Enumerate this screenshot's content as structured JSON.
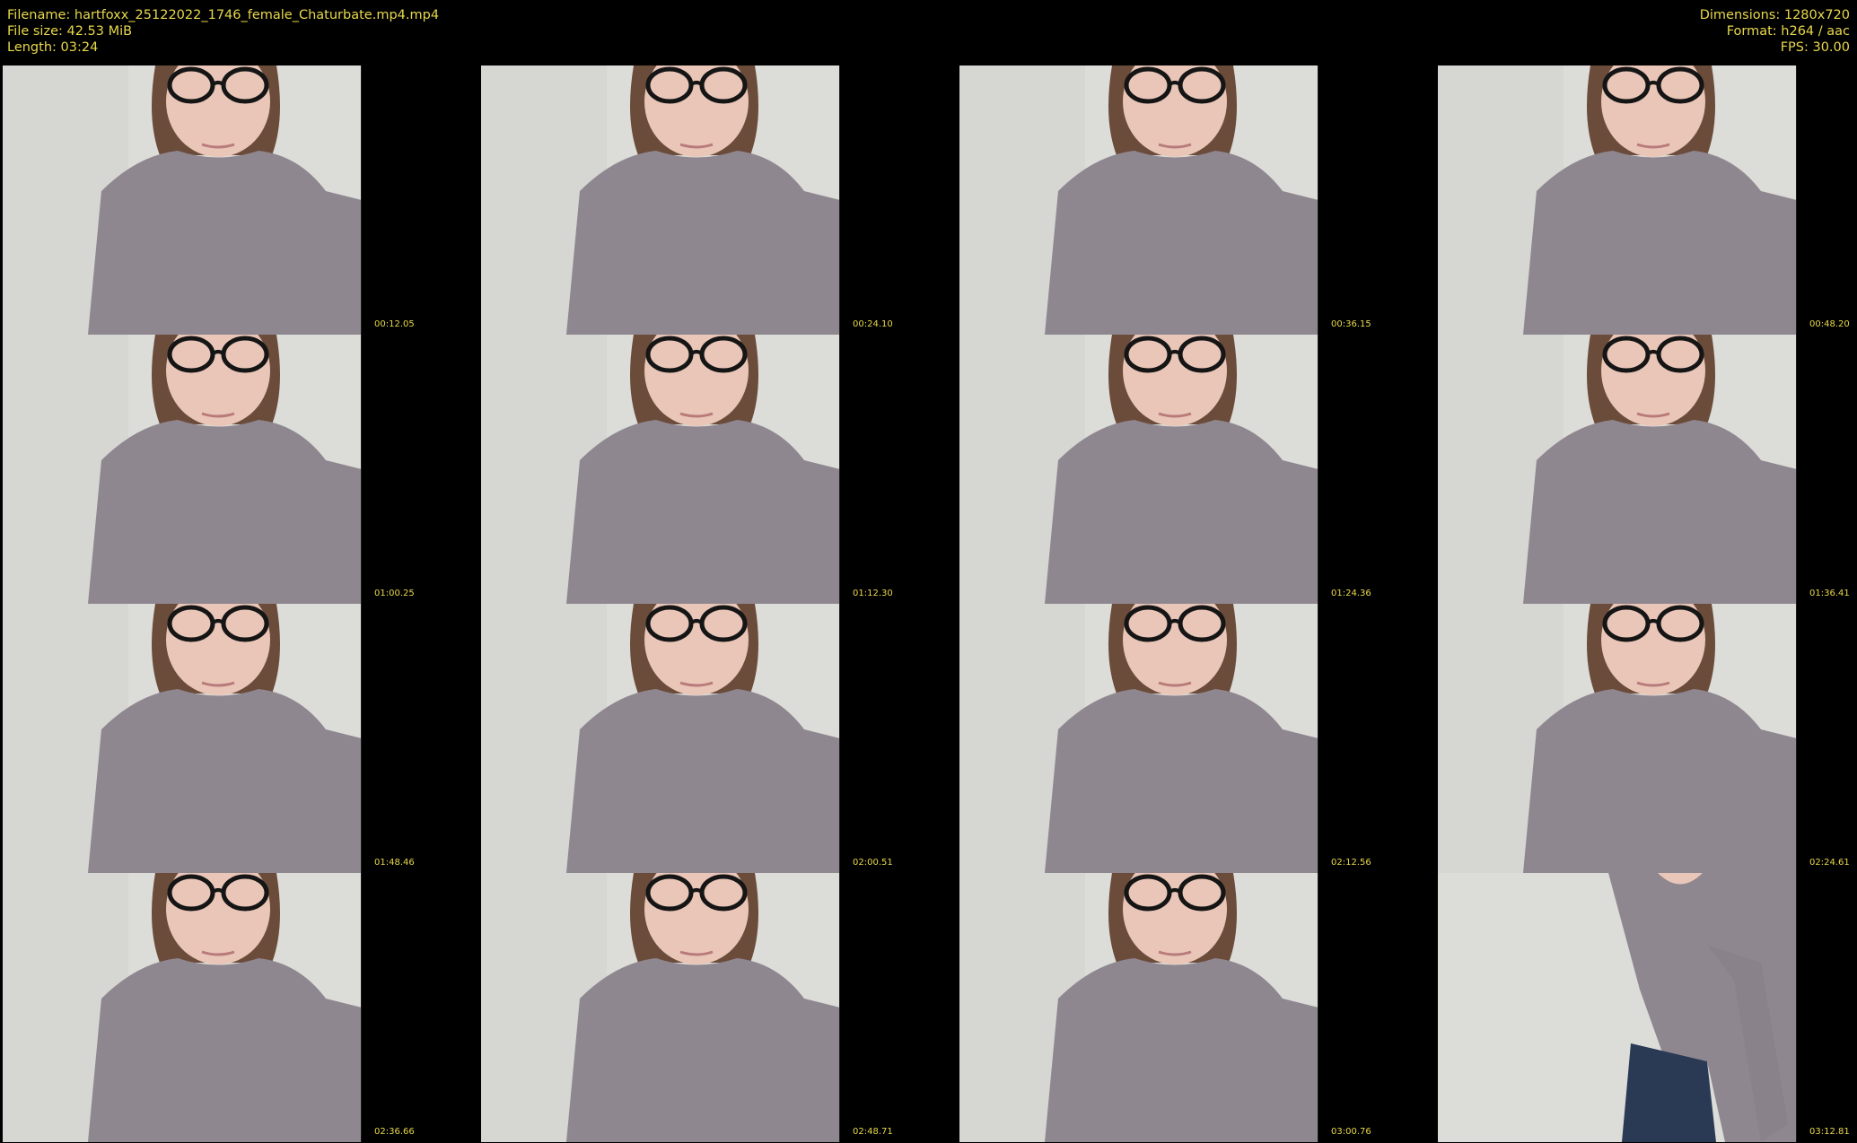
{
  "header": {
    "filename": "Filename: hartfoxx_25122022_1746_female_Chaturbate.mp4.mp4",
    "filesize": "File size: 42.53 MiB",
    "length": "Length: 03:24",
    "dimensions": "Dimensions: 1280x720",
    "format": "Format: h264 / aac",
    "fps": "FPS: 30.00"
  },
  "colors": {
    "background": "#000000",
    "text": "#e8d84a",
    "wall": "#dcdcd8",
    "sweater": "#8f8790",
    "hair": "#6b4c3a",
    "skin": "#e9c6b8"
  },
  "thumbnails": [
    {
      "time": "00:12.05",
      "pose": "face"
    },
    {
      "time": "00:24.10",
      "pose": "face"
    },
    {
      "time": "00:36.15",
      "pose": "face"
    },
    {
      "time": "00:48.20",
      "pose": "face"
    },
    {
      "time": "01:00.25",
      "pose": "face"
    },
    {
      "time": "01:12.30",
      "pose": "face"
    },
    {
      "time": "01:24.36",
      "pose": "face"
    },
    {
      "time": "01:36.41",
      "pose": "face"
    },
    {
      "time": "01:48.46",
      "pose": "face"
    },
    {
      "time": "02:00.51",
      "pose": "face"
    },
    {
      "time": "02:12.56",
      "pose": "face"
    },
    {
      "time": "02:24.61",
      "pose": "face"
    },
    {
      "time": "02:36.66",
      "pose": "face"
    },
    {
      "time": "02:48.71",
      "pose": "face"
    },
    {
      "time": "03:00.76",
      "pose": "face"
    },
    {
      "time": "03:12.81",
      "pose": "body"
    }
  ]
}
